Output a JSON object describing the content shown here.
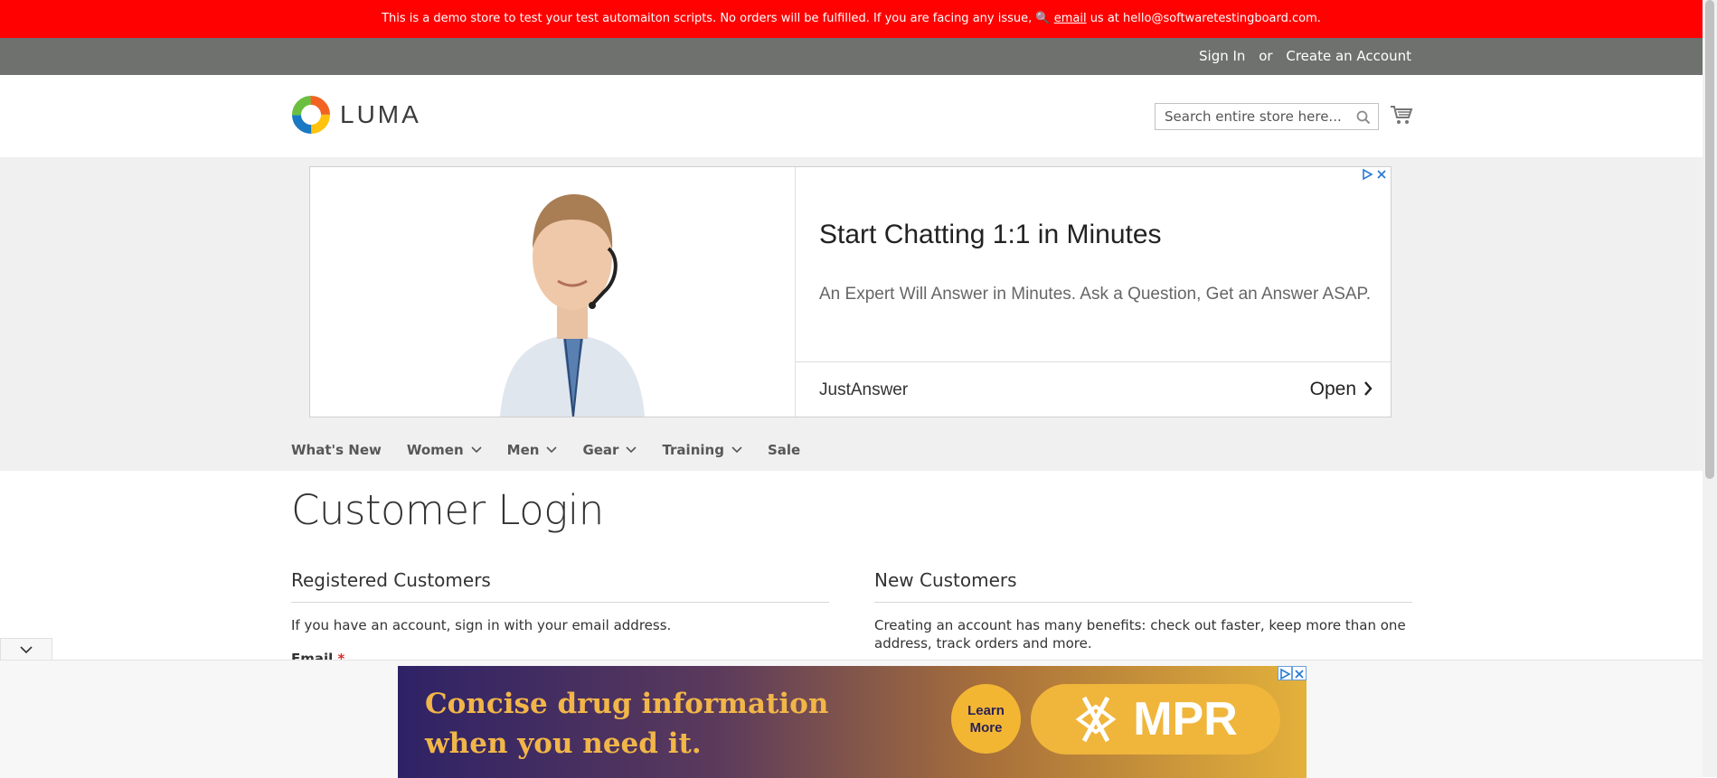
{
  "demo_notice": {
    "text_before": "This is a demo store to test your test automaiton scripts. No orders will be fulfilled. If you are facing any issue, 🔍 ",
    "link": "email",
    "text_after": " us at hello@softwaretestingboard.com."
  },
  "panel": {
    "sign_in": "Sign In",
    "or": "or",
    "create_account": "Create an Account"
  },
  "header": {
    "logo_text": "LUMA",
    "search_placeholder": "Search entire store here...",
    "icons": {
      "search": "magnifier-icon",
      "cart": "shopping-cart-icon"
    }
  },
  "ad_top": {
    "title": "Start Chatting 1:1 in Minutes",
    "description": "An Expert Will Answer in Minutes. Ask a Question, Get an Answer ASAP.",
    "brand": "JustAnswer",
    "cta": "Open",
    "icons": {
      "adchoices": "adchoices-icon",
      "close": "close-icon"
    }
  },
  "nav": {
    "items": [
      {
        "label": "What's New",
        "has_dropdown": false
      },
      {
        "label": "Women",
        "has_dropdown": true
      },
      {
        "label": "Men",
        "has_dropdown": true
      },
      {
        "label": "Gear",
        "has_dropdown": true
      },
      {
        "label": "Training",
        "has_dropdown": true
      },
      {
        "label": "Sale",
        "has_dropdown": false
      }
    ]
  },
  "main": {
    "page_title": "Customer Login",
    "registered": {
      "title": "Registered Customers",
      "text": "If you have an account, sign in with your email address.",
      "email_label": "Email",
      "required_mark": "*"
    },
    "new_customers": {
      "title": "New Customers",
      "text": "Creating an account has many benefits: check out faster, keep more than one address, track orders and more."
    }
  },
  "ad_bottom": {
    "text": "Concise drug information when you need it.",
    "button": "Learn More",
    "brand": "MPR"
  },
  "colors": {
    "demo_bar": "#ff0101",
    "panel": "#6e716e",
    "nav_bg": "#f0f0f0"
  }
}
